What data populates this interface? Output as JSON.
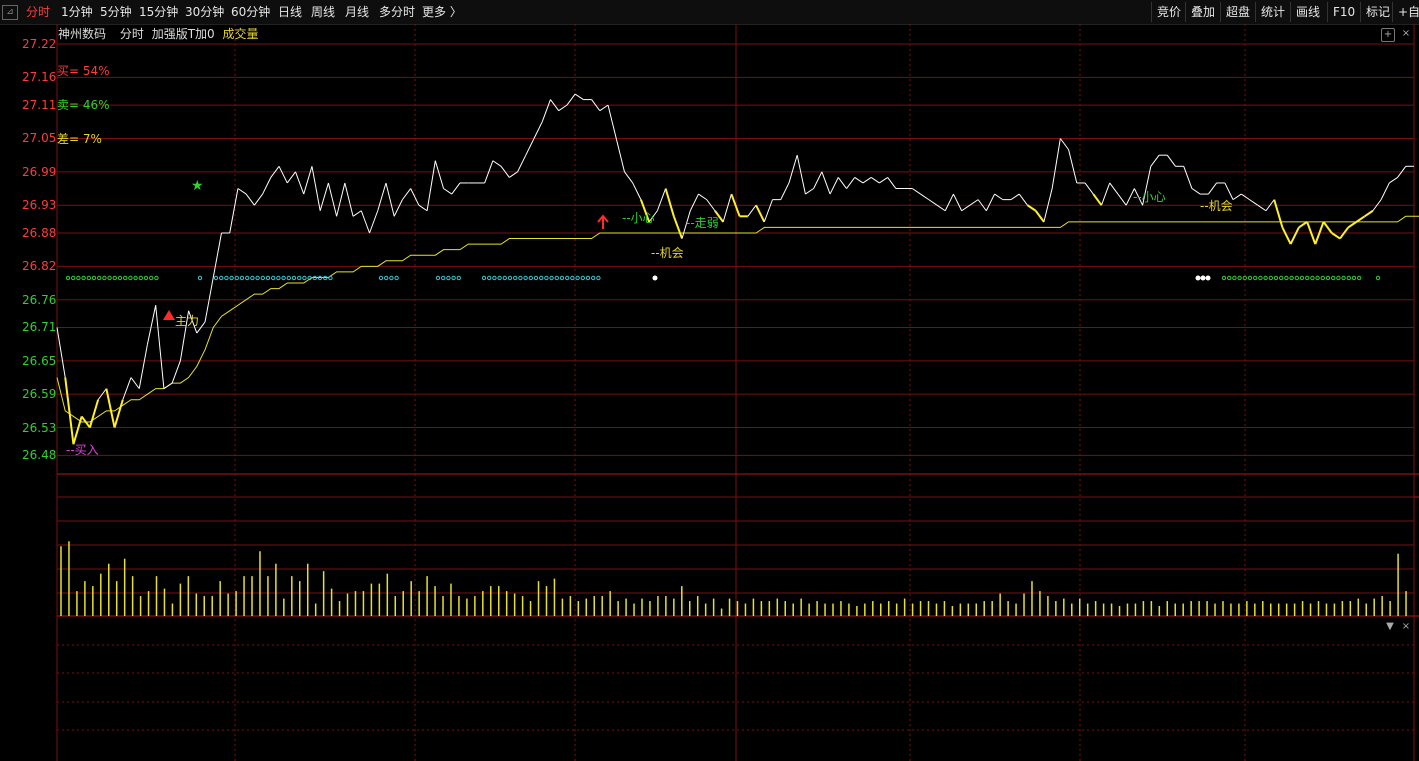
{
  "toolbar": {
    "window_icon": "⊿",
    "periods": [
      "分时",
      "1分钟",
      "5分钟",
      "15分钟",
      "30分钟",
      "60分钟",
      "日线",
      "周线",
      "月线",
      "多分时",
      "更多 〉"
    ],
    "active_period": "分时",
    "right_buttons": [
      "竞价",
      "叠加",
      "超盘",
      "统计",
      "画线",
      "F10",
      "标记",
      "+自"
    ]
  },
  "stock": {
    "name": "神州数码",
    "chart_mode": "分时",
    "indicator": "加强版T加0",
    "volume_label": "成交量"
  },
  "stats": {
    "buy": "买= 54%",
    "sell": "卖= 46%",
    "diff": "差= 7%"
  },
  "colors": {
    "up": "#ff3b3b",
    "down": "#2fd12f",
    "price_line": "#ffffff",
    "avg_line": "#e6e12c",
    "volume": "#e6e12c",
    "grid": "#7a0f0f",
    "dot_green": "#2fd12f",
    "dot_cyan": "#35c8d6"
  },
  "signals": {
    "buy_in": "--买入",
    "main_force": "主力",
    "careful_1": "--小心",
    "weak": "--走弱",
    "chance_1": "--机会",
    "careful_2": "--小心",
    "chance_2": "--机会"
  },
  "chart_data": {
    "type": "line",
    "y_ticks": [
      "27.22",
      "27.16",
      "27.11",
      "27.05",
      "26.99",
      "26.93",
      "26.88",
      "26.82",
      "26.76",
      "26.71",
      "26.65",
      "26.59",
      "26.53",
      "26.48"
    ],
    "ylim": [
      26.45,
      27.22
    ],
    "price": [
      26.71,
      26.62,
      26.5,
      26.55,
      26.53,
      26.58,
      26.6,
      26.53,
      26.58,
      26.62,
      26.6,
      26.68,
      26.75,
      26.6,
      26.61,
      26.65,
      26.74,
      26.7,
      26.72,
      26.8,
      26.88,
      26.88,
      26.96,
      26.95,
      26.93,
      26.95,
      26.98,
      27.0,
      26.97,
      26.99,
      26.95,
      27.0,
      26.92,
      26.97,
      26.91,
      26.97,
      26.91,
      26.92,
      26.88,
      26.92,
      26.97,
      26.91,
      26.94,
      26.96,
      26.93,
      26.92,
      27.01,
      26.96,
      26.95,
      26.97,
      26.97,
      26.97,
      26.97,
      27.01,
      27.0,
      26.98,
      26.99,
      27.02,
      27.05,
      27.08,
      27.12,
      27.1,
      27.11,
      27.13,
      27.12,
      27.12,
      27.1,
      27.11,
      27.05,
      26.99,
      26.97,
      26.94,
      26.9,
      26.92,
      26.96,
      26.91,
      26.87,
      26.92,
      26.95,
      26.94,
      26.92,
      26.9,
      26.95,
      26.91,
      26.91,
      26.93,
      26.9,
      26.94,
      26.94,
      26.97,
      27.02,
      26.95,
      26.96,
      26.99,
      26.95,
      26.98,
      26.96,
      26.98,
      26.97,
      26.98,
      26.97,
      26.98,
      26.96,
      26.96,
      26.96,
      26.95,
      26.94,
      26.93,
      26.92,
      26.95,
      26.92,
      26.93,
      26.94,
      26.92,
      26.95,
      26.94,
      26.94,
      26.95,
      26.93,
      26.92,
      26.9,
      26.96,
      27.05,
      27.03,
      26.97,
      26.97,
      26.95,
      26.93,
      26.97,
      26.95,
      26.93,
      26.96,
      26.93,
      27.0,
      27.02,
      27.02,
      27.0,
      27.0,
      26.96,
      26.95,
      26.95,
      26.97,
      26.97,
      26.94,
      26.95,
      26.94,
      26.93,
      26.92,
      26.94,
      26.89,
      26.86,
      26.89,
      26.9,
      26.86,
      26.9,
      26.88,
      26.87,
      26.89,
      26.9,
      26.91,
      26.92,
      26.94,
      26.97,
      26.98,
      27.0,
      27.0
    ],
    "avg": [
      26.62,
      26.56,
      26.55,
      26.54,
      26.54,
      26.55,
      26.56,
      26.56,
      26.57,
      26.58,
      26.58,
      26.59,
      26.6,
      26.6,
      26.61,
      26.61,
      26.62,
      26.64,
      26.67,
      26.71,
      26.73,
      26.74,
      26.75,
      26.76,
      26.77,
      26.77,
      26.78,
      26.78,
      26.79,
      26.79,
      26.79,
      26.8,
      26.8,
      26.8,
      26.81,
      26.81,
      26.81,
      26.82,
      26.82,
      26.82,
      26.83,
      26.83,
      26.83,
      26.84,
      26.84,
      26.84,
      26.84,
      26.85,
      26.85,
      26.85,
      26.86,
      26.86,
      26.86,
      26.86,
      26.86,
      26.87,
      26.87,
      26.87,
      26.87,
      26.87,
      26.87,
      26.87,
      26.87,
      26.87,
      26.87,
      26.87,
      26.88,
      26.88,
      26.88,
      26.88,
      26.88,
      26.88,
      26.88,
      26.88,
      26.88,
      26.88,
      26.88,
      26.88,
      26.88,
      26.88,
      26.88,
      26.88,
      26.88,
      26.88,
      26.88,
      26.88,
      26.89,
      26.89,
      26.89,
      26.89,
      26.89,
      26.89,
      26.89,
      26.89,
      26.89,
      26.89,
      26.89,
      26.89,
      26.89,
      26.89,
      26.89,
      26.89,
      26.89,
      26.89,
      26.89,
      26.89,
      26.89,
      26.89,
      26.89,
      26.89,
      26.89,
      26.89,
      26.89,
      26.89,
      26.89,
      26.89,
      26.89,
      26.89,
      26.89,
      26.89,
      26.89,
      26.89,
      26.89,
      26.9,
      26.9,
      26.9,
      26.9,
      26.9,
      26.9,
      26.9,
      26.9,
      26.9,
      26.9,
      26.9,
      26.9,
      26.9,
      26.9,
      26.9,
      26.9,
      26.9,
      26.9,
      26.9,
      26.9,
      26.9,
      26.9,
      26.9,
      26.9,
      26.9,
      26.9,
      26.9,
      26.9,
      26.9,
      26.9,
      26.9,
      26.9,
      26.9,
      26.9,
      26.9,
      26.9,
      26.9,
      26.9,
      26.9,
      26.9,
      26.9,
      26.91,
      26.91,
      26.91
    ],
    "volume": [
      0.28,
      0.3,
      0.1,
      0.14,
      0.12,
      0.17,
      0.21,
      0.14,
      0.23,
      0.16,
      0.08,
      0.1,
      0.16,
      0.11,
      0.05,
      0.13,
      0.16,
      0.09,
      0.08,
      0.08,
      0.14,
      0.09,
      0.1,
      0.16,
      0.16,
      0.26,
      0.16,
      0.21,
      0.07,
      0.16,
      0.14,
      0.21,
      0.05,
      0.18,
      0.11,
      0.06,
      0.09,
      0.1,
      0.1,
      0.13,
      0.13,
      0.17,
      0.08,
      0.1,
      0.14,
      0.1,
      0.16,
      0.12,
      0.08,
      0.13,
      0.08,
      0.07,
      0.08,
      0.1,
      0.12,
      0.12,
      0.1,
      0.09,
      0.08,
      0.06,
      0.14,
      0.12,
      0.15,
      0.07,
      0.08,
      0.06,
      0.07,
      0.08,
      0.08,
      0.1,
      0.06,
      0.07,
      0.05,
      0.07,
      0.06,
      0.08,
      0.08,
      0.07,
      0.12,
      0.06,
      0.08,
      0.05,
      0.07,
      0.03,
      0.07,
      0.06,
      0.05,
      0.07,
      0.06,
      0.06,
      0.07,
      0.06,
      0.05,
      0.07,
      0.05,
      0.06,
      0.05,
      0.05,
      0.06,
      0.05,
      0.04,
      0.05,
      0.06,
      0.05,
      0.06,
      0.05,
      0.07,
      0.05,
      0.06,
      0.06,
      0.05,
      0.06,
      0.04,
      0.05,
      0.05,
      0.05,
      0.06,
      0.06,
      0.09,
      0.06,
      0.05,
      0.09,
      0.14,
      0.1,
      0.08,
      0.06,
      0.07,
      0.05,
      0.07,
      0.05,
      0.06,
      0.05,
      0.05,
      0.04,
      0.05,
      0.05,
      0.06,
      0.06,
      0.04,
      0.06,
      0.05,
      0.05,
      0.06,
      0.06,
      0.06,
      0.05,
      0.06,
      0.05,
      0.05,
      0.06,
      0.05,
      0.06,
      0.05,
      0.05,
      0.05,
      0.05,
      0.06,
      0.05,
      0.06,
      0.05,
      0.05,
      0.06,
      0.06,
      0.07,
      0.05,
      0.07,
      0.08,
      0.06,
      0.25,
      0.1
    ]
  }
}
